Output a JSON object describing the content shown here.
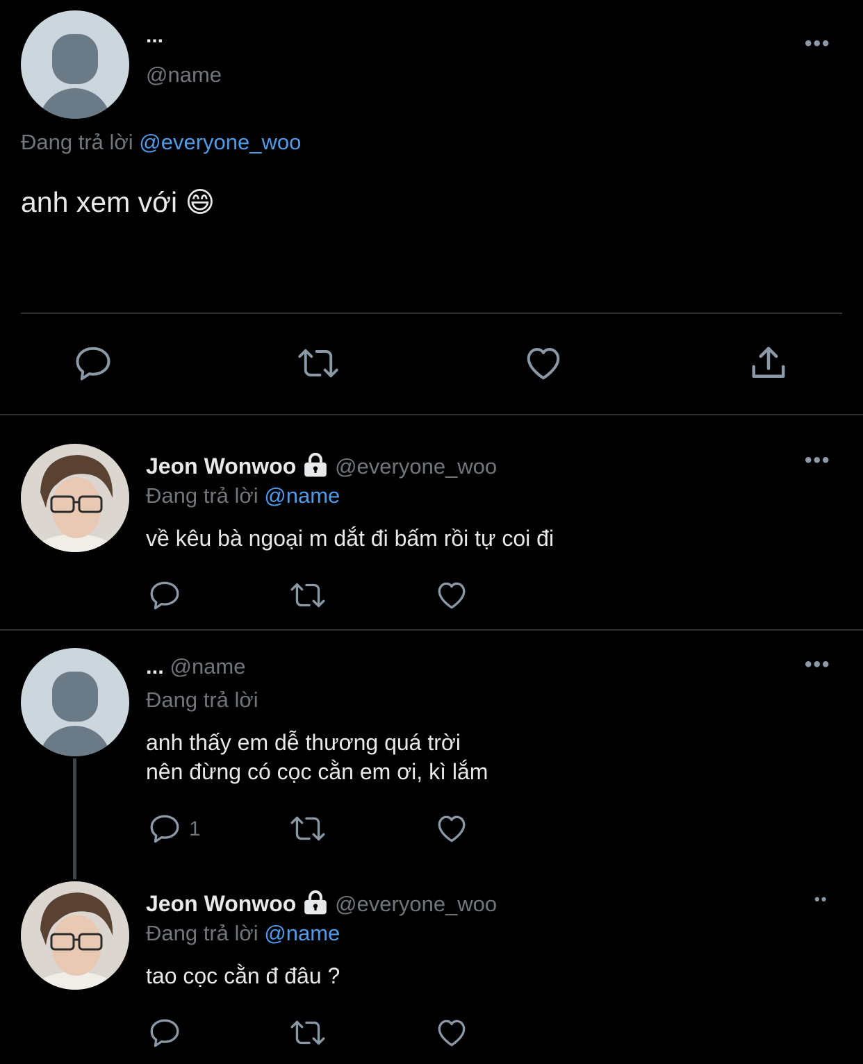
{
  "main_tweet": {
    "display_name": "...",
    "handle": "@name",
    "reply_prefix": "Đang trả lời",
    "reply_to": "@everyone_woo",
    "text": "anh xem với 😄"
  },
  "replies": [
    {
      "display_name": "Jeon Wonwoo",
      "handle": "@everyone_woo",
      "reply_prefix": "Đang trả lời",
      "reply_to": "@name",
      "text": "về kêu bà ngoại m dắt đi bấm rồi tự coi đi",
      "reply_count": ""
    },
    {
      "display_name": "...",
      "handle": "@name",
      "reply_prefix": "Đang trả lời",
      "reply_to": "",
      "text_line1": "anh thấy em dễ thương quá trời",
      "text_line2": "nên đừng có cọc cằn em ơi, kì lắm",
      "reply_count": "1"
    },
    {
      "display_name": "Jeon Wonwoo",
      "handle": "@everyone_woo",
      "reply_prefix": "Đang trả lời",
      "reply_to": "@name",
      "text": "tao cọc cằn đ đâu ?",
      "reply_count": ""
    }
  ],
  "colors": {
    "background": "#000000",
    "text": "#e7e9ea",
    "secondary": "#71767b",
    "link": "#4f9be8",
    "icon": "#8b98a5"
  }
}
